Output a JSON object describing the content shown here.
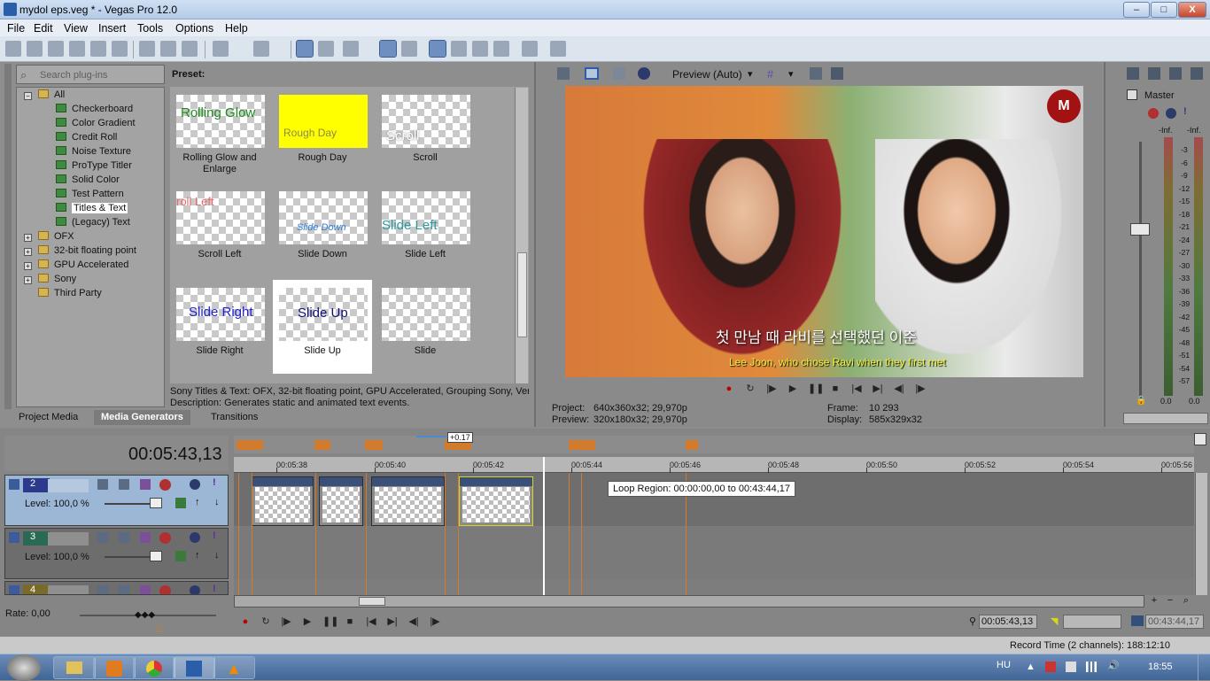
{
  "window": {
    "title": "mydol eps.veg * - Vegas Pro 12.0",
    "min": "–",
    "max": "□",
    "close": "X"
  },
  "menu": [
    "File",
    "Edit",
    "View",
    "Insert",
    "Tools",
    "Options",
    "Help"
  ],
  "explorer": {
    "search_placeholder": "Search plug-ins",
    "preset_label": "Preset:",
    "tree": [
      {
        "label": "All",
        "type": "folder",
        "expanded": true
      },
      {
        "label": "Checkerboard",
        "type": "fx"
      },
      {
        "label": "Color Gradient",
        "type": "fx"
      },
      {
        "label": "Credit Roll",
        "type": "fx"
      },
      {
        "label": "Noise Texture",
        "type": "fx"
      },
      {
        "label": "ProType Titler",
        "type": "fx"
      },
      {
        "label": "Solid Color",
        "type": "fx"
      },
      {
        "label": "Test Pattern",
        "type": "fx"
      },
      {
        "label": "Titles & Text",
        "type": "fx",
        "selected": true
      },
      {
        "label": "(Legacy) Text",
        "type": "fx"
      },
      {
        "label": "OFX",
        "type": "folder"
      },
      {
        "label": "32-bit floating point",
        "type": "folder"
      },
      {
        "label": "GPU Accelerated",
        "type": "folder"
      },
      {
        "label": "Sony",
        "type": "folder"
      },
      {
        "label": "Third Party",
        "type": "folder"
      }
    ],
    "presets": [
      {
        "thumb": "Rolling Glow",
        "label": "Rolling Glow and Enlarge",
        "color": "#1f8a1f"
      },
      {
        "thumb": "Rough Day",
        "label": "Rough Day",
        "color": "#7a7a7a",
        "bg": "#ffff00"
      },
      {
        "thumb": "Scroll",
        "label": "Scroll",
        "color": "#ffffff"
      },
      {
        "thumb": "roll Left",
        "label": "Scroll Left",
        "color": "#e86a6a"
      },
      {
        "thumb": "Slide Down",
        "label": "Slide Down",
        "color": "#2c7fd1"
      },
      {
        "thumb": "Slide Left",
        "label": "Slide Left",
        "color": "#2a9aa0"
      },
      {
        "thumb": "Slide Right",
        "label": "Slide Right",
        "color": "#1f1fd4"
      },
      {
        "thumb": "Slide Up",
        "label": "Slide Up",
        "color": "#10107a",
        "selected": true
      },
      {
        "thumb": "",
        "label": "Slide",
        "color": "#000000"
      }
    ],
    "description_line1": "Sony Titles & Text: OFX, 32-bit floating point, GPU Accelerated, Grouping Sony, Ver:",
    "description_line2": "Description: Generates static and animated text events.",
    "tabs": [
      "Project Media",
      "Media Generators",
      "Transitions"
    ]
  },
  "preview": {
    "mode": "Preview (Auto)",
    "subtitle_ko": "첫 만남 때 라비를 선택했던 이준",
    "subtitle_en": "Lee Joon, who chose Ravi when they first met",
    "project_label": "Project:",
    "project_value": "640x360x32; 29,970p",
    "preview_label": "Preview:",
    "preview_value": "320x180x32; 29,970p",
    "frame_label": "Frame:",
    "frame_value": "10 293",
    "display_label": "Display:",
    "display_value": "585x329x32"
  },
  "mixer": {
    "master": "Master",
    "inf_l": "-Inf.",
    "inf_r": "-Inf.",
    "scale": [
      "3",
      "6",
      "9",
      "12",
      "15",
      "18",
      "21",
      "24",
      "27",
      "30",
      "33",
      "36",
      "39",
      "42",
      "45",
      "48",
      "51",
      "54",
      "57"
    ],
    "bottom_l": "0.0",
    "bottom_r": "0.0"
  },
  "timeline": {
    "timecode": "00:05:43,13",
    "offset": "+0.17",
    "ruler": [
      "00:05:38",
      "00:05:40",
      "00:05:42",
      "00:05:44",
      "00:05:46",
      "00:05:48",
      "00:05:50",
      "00:05:52",
      "00:05:54",
      "00:05:56"
    ],
    "tracks": [
      {
        "num": "2",
        "level": "Level: 100,0 %",
        "color": "#2b3a8a"
      },
      {
        "num": "3",
        "level": "Level: 100,0 %",
        "color": "#2a6a55"
      },
      {
        "num": "4",
        "level": "",
        "color": "#7a6a2a"
      }
    ],
    "tooltip": "Loop Region: 00:00:00,00 to 00:43:44,17",
    "rate": "Rate: 0,00",
    "cursor_time": "00:05:43,13",
    "sel_time": "00:43:44,17"
  },
  "status": {
    "record": "Record Time (2 channels): 188:12:10"
  },
  "taskbar": {
    "lang": "HU",
    "clock": "18:55"
  }
}
